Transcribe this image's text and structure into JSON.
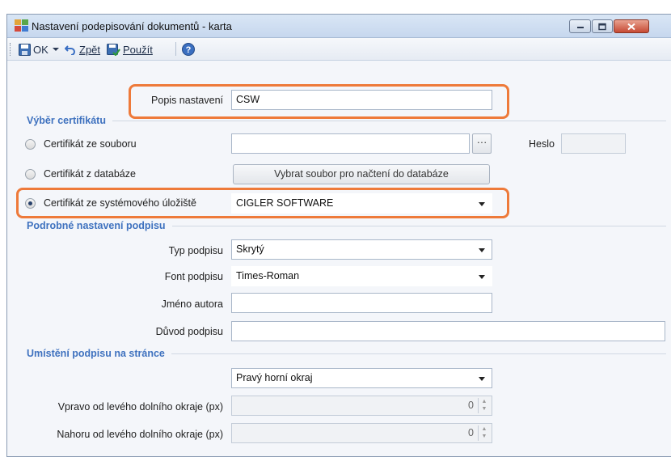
{
  "window": {
    "title": "Nastavení podepisování dokumentů - karta"
  },
  "toolbar": {
    "ok_label": "OK",
    "back_label": "Zpět",
    "apply_label": "Použít"
  },
  "form": {
    "popis_label": "Popis nastavení",
    "popis_value": "CSW",
    "section_cert": "Výběr certifikátu",
    "cert_file_label": "Certifikát ze souboru",
    "cert_file_value": "",
    "browse_label": "···",
    "password_label": "Heslo",
    "password_value": "",
    "cert_db_label": "Certifikát z databáze",
    "select_file_button": "Vybrat soubor pro načtení do databáze",
    "cert_store_label": "Certifikát ze systémového úložiště",
    "cert_store_value": "CIGLER SOFTWARE",
    "selected_cert_source": "Certifikát ze systémového úložiště",
    "section_detail": "Podrobné nastavení podpisu",
    "sig_type_label": "Typ podpisu",
    "sig_type_value": "Skrytý",
    "font_label": "Font podpisu",
    "font_value": "Times-Roman",
    "author_label": "Jméno autora",
    "author_value": "",
    "reason_label": "Důvod podpisu",
    "reason_value": "",
    "section_position": "Umístění podpisu na stránce",
    "position_value": "Pravý horní okraj",
    "right_offset_label": "Vpravo od levého dolního okraje (px)",
    "right_offset_value": "0",
    "up_offset_label": "Nahoru od levého dolního okraje (px)",
    "up_offset_value": "0"
  },
  "colors": {
    "highlight": "#ee7a3a",
    "section_heading": "#3f72bf"
  }
}
